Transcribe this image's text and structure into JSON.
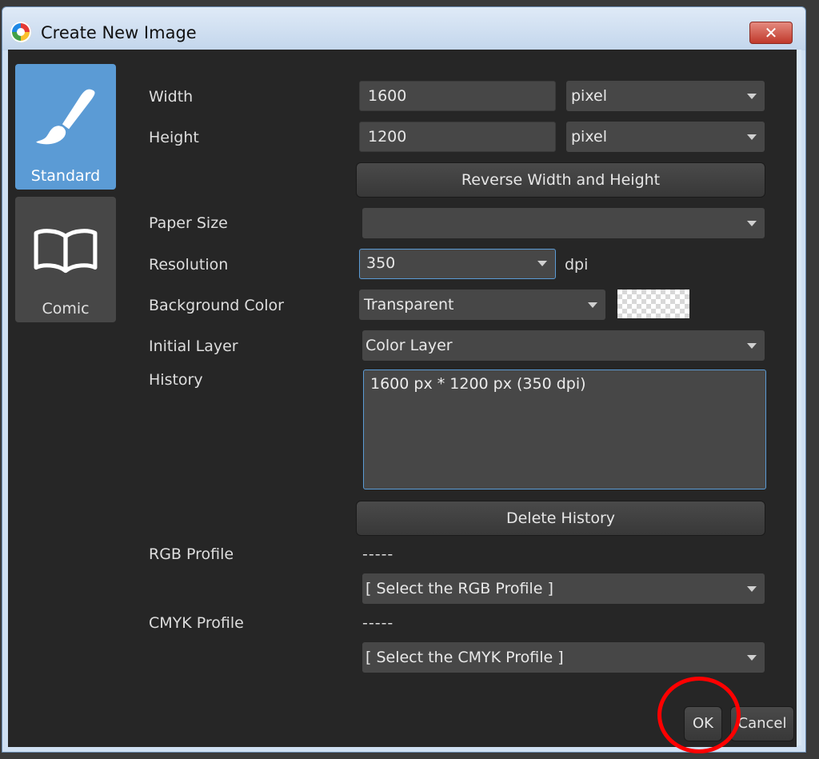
{
  "window": {
    "title": "Create New Image",
    "close_symbol": "✕"
  },
  "nav": {
    "standard": {
      "label": "Standard",
      "icon": "brush-icon"
    },
    "comic": {
      "label": "Comic",
      "icon": "book-icon"
    }
  },
  "form": {
    "width": {
      "label": "Width",
      "value": "1600",
      "unit": "pixel"
    },
    "height": {
      "label": "Height",
      "value": "1200",
      "unit": "pixel"
    },
    "reverse_button": "Reverse Width and Height",
    "paper_size": {
      "label": "Paper Size",
      "value": ""
    },
    "resolution": {
      "label": "Resolution",
      "value": "350",
      "unit": "dpi"
    },
    "background_color": {
      "label": "Background Color",
      "value": "Transparent"
    },
    "initial_layer": {
      "label": "Initial Layer",
      "value": "Color Layer"
    },
    "history": {
      "label": "History",
      "entries": "1600 px * 1200 px (350 dpi)"
    },
    "delete_history_button": "Delete History",
    "rgb_profile": {
      "label": "RGB Profile",
      "current": "-----",
      "select": "[ Select the RGB Profile ]"
    },
    "cmyk_profile": {
      "label": "CMYK Profile",
      "current": "-----",
      "select": "[ Select the CMYK Profile ]"
    }
  },
  "footer": {
    "ok": "OK",
    "cancel": "Cancel"
  },
  "colors": {
    "accent": "#5b9bd5",
    "annotation": "#ff0000"
  }
}
